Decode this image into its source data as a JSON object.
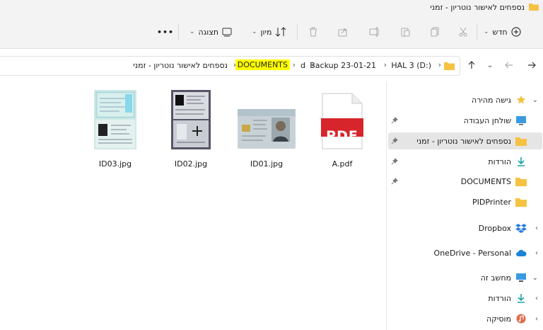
{
  "window": {
    "title": "נספחים לאישור נוטריון - זמני"
  },
  "toolbar": {
    "new_label": "חדש",
    "sort_label": "מיון",
    "view_label": "תצוגה",
    "more_label": "•••"
  },
  "address": {
    "crumbs": [
      "HAL 3 (D:)",
      "Backup 23-01-21",
      "d",
      "DOCUMENTS",
      "נספחים לאישור נוטריון - זמני"
    ],
    "highlighted_crumb": "DOCUMENTS",
    "highlight_color": "#ffff00"
  },
  "nav": {
    "quick_access": "גישה מהירה",
    "items": [
      {
        "label": "שולחן העבודה",
        "icon": "desktop-icon",
        "pinned": true
      },
      {
        "label": "נספחים לאישור נוטריון - זמני",
        "icon": "folder-icon",
        "pinned": true,
        "selected": true
      },
      {
        "label": "הורדות",
        "icon": "download-icon",
        "pinned": true
      },
      {
        "label": "DOCUMENTS",
        "icon": "folder-icon",
        "pinned": true
      },
      {
        "label": "PIDPrinter",
        "icon": "folder-icon",
        "pinned": false
      }
    ],
    "dropbox": "Dropbox",
    "onedrive": "OneDrive - Personal",
    "this_pc": "מחשב זה",
    "pc_items": [
      {
        "label": "הורדות",
        "icon": "download-icon"
      },
      {
        "label": "מוסיקה",
        "icon": "music-icon"
      }
    ]
  },
  "files": [
    {
      "name": "ID03.jpg",
      "type": "id-passport"
    },
    {
      "name": "ID02.jpg",
      "type": "id-booklet"
    },
    {
      "name": "ID01.jpg",
      "type": "id-card"
    },
    {
      "name": "A.pdf",
      "type": "pdf",
      "badge": "PDF"
    }
  ],
  "colors": {
    "folder": "#f6c242",
    "pdf_red": "#d6262b",
    "accent": "#0a64c8"
  }
}
